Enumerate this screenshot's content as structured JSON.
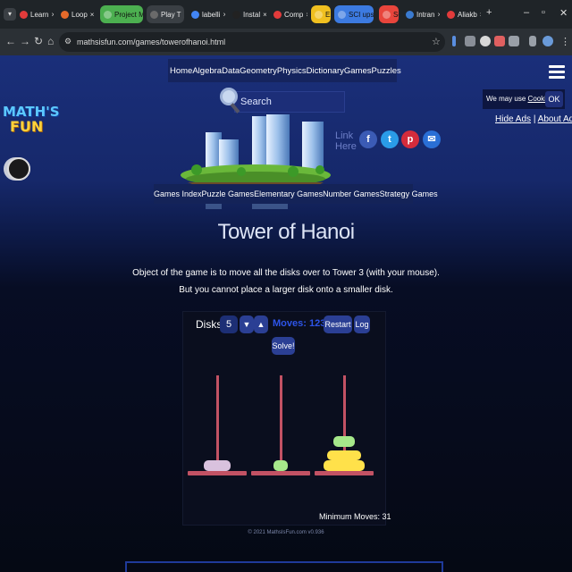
{
  "browser": {
    "tabs": [
      {
        "label": "Learn",
        "color": "#e23b3b"
      },
      {
        "label": "Loop",
        "color": "#e66a2a"
      },
      {
        "label": "Project Marion",
        "color": "#4caf50",
        "group": true
      },
      {
        "label": "Play T",
        "color": "#6a6a6a",
        "active": true
      },
      {
        "label": "labelli",
        "color": "#4285f4"
      },
      {
        "label": "Instal",
        "color": "#222222"
      },
      {
        "label": "Comp",
        "color": "#e23b3b"
      },
      {
        "label": "EXCI",
        "color": "#f0c020",
        "group": true
      },
      {
        "label": "SCI upsolve",
        "color": "#3c7ae0",
        "group": true
      },
      {
        "label": "School",
        "color": "#e8453c",
        "group": true
      },
      {
        "label": "Intran",
        "color": "#3a7ad0"
      },
      {
        "label": "Aliakb",
        "color": "#e23b3b"
      }
    ],
    "url": "mathsisfun.com/games/towerofhanoi.html"
  },
  "nav": {
    "items": [
      "Home",
      "Algebra",
      "Data",
      "Geometry",
      "Physics",
      "Dictionary",
      "Games",
      "Puzzles"
    ]
  },
  "search": {
    "placeholder": "Search"
  },
  "logo": {
    "line1": "MATH'S",
    "line2": "FUN"
  },
  "link_here": "Link Here",
  "consent": {
    "text": "We may use",
    "link": "Cookies",
    "ok": "OK"
  },
  "ads": {
    "hide": "Hide Ads",
    "sep": "|",
    "about": "About Ads"
  },
  "subnav": {
    "items": [
      "Games Index",
      "Puzzle Games",
      "Elementary Games",
      "Number Games",
      "Strategy Games"
    ]
  },
  "page": {
    "title": "Tower of Hanoi",
    "desc_line1": "Object of the game is to move all the disks over to Tower 3 (with your mouse).",
    "desc_line2": "But you cannot place a larger disk onto a smaller disk."
  },
  "game": {
    "disks_label": "Disks:",
    "disks_count": "5",
    "down_symbol": "▼",
    "up_symbol": "▲",
    "moves_text": "Moves: 123",
    "restart_label": "Restart",
    "log_label": "Log",
    "solve_label": "Solve!",
    "min_moves": "Minimum Moves: 31",
    "copyright": "© 2021 MathsIsFun.com v0.936",
    "disk_colors": {
      "lavender": "#d9c2de",
      "green": "#a6e88a",
      "yellow": "#ffe14a"
    }
  }
}
